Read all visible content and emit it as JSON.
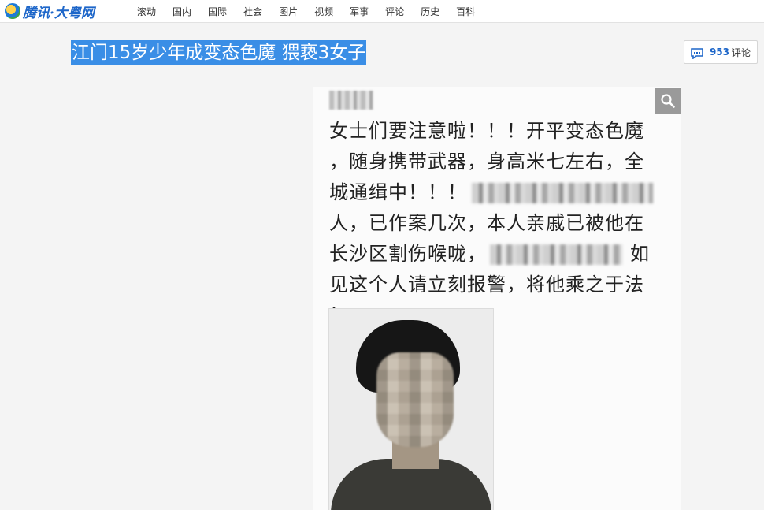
{
  "site": {
    "logo_text": "腾讯·大粤网"
  },
  "nav": [
    "滚动",
    "国内",
    "国际",
    "社会",
    "图片",
    "视频",
    "军事",
    "评论",
    "历史",
    "百科"
  ],
  "article": {
    "headline": "江门15岁少年成变态色魔 猥亵3女子"
  },
  "comments": {
    "count": "953",
    "label": "评论"
  },
  "image": {
    "lines": [
      "女士们要注意啦！！！开平变态色魔",
      "，随身携带武器，身高米七左右，全",
      "城通缉中！！！",
      "人，已作案几次，本人亲戚已被他在",
      "长沙区割伤喉咙，",
      "如",
      "见这个人请立刻报警，将他乘之于法",
      "！"
    ]
  },
  "colors": {
    "accent": "#1d66c9",
    "highlight": "#3a8ee6"
  }
}
